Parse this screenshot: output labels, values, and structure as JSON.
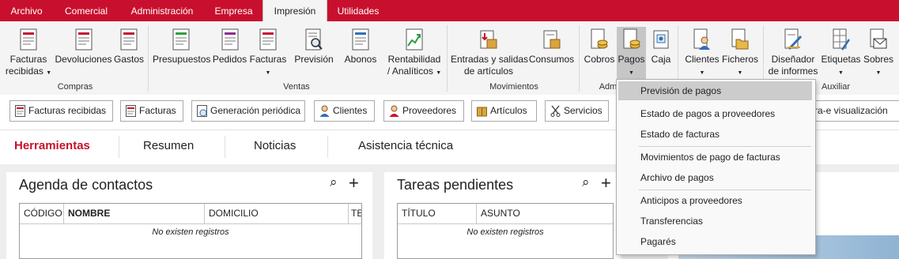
{
  "menu": {
    "tabs": [
      "Archivo",
      "Comercial",
      "Administración",
      "Empresa",
      "Impresión",
      "Utilidades"
    ],
    "active": "Impresión"
  },
  "ribbon": {
    "groups": {
      "compras": "Compras",
      "ventas": "Ventas",
      "movimientos": "Movimientos",
      "administracion": "Adm",
      "auxiliar": "Auxiliar"
    },
    "buttons": {
      "facturas_recibidas_1": "Facturas",
      "facturas_recibidas_2": "recibidas",
      "devoluciones": "Devoluciones",
      "gastos": "Gastos",
      "presupuestos": "Presupuestos",
      "pedidos": "Pedidos",
      "facturas": "Facturas",
      "prevision": "Previsión",
      "abonos": "Abonos",
      "rentabilidad_1": "Rentabilidad",
      "rentabilidad_2": "/ Analíticos",
      "entradas_1": "Entradas y salidas",
      "entradas_2": "de artículos",
      "consumos": "Consumos",
      "cobros": "Cobros",
      "pagos": "Pagos",
      "caja": "Caja",
      "clientes": "Clientes",
      "ficheros": "Ficheros",
      "disenador_1": "Diseñador",
      "disenador_2": "de informes",
      "etiquetas": "Etiquetas",
      "sobres": "Sobres"
    }
  },
  "shortcuts": {
    "facturas_recibidas": "Facturas recibidas",
    "facturas": "Facturas",
    "generacion_periodica": "Generación periódica",
    "clientes": "Clientes",
    "proveedores": "Proveedores",
    "articulos": "Artículos",
    "servicios": "Servicios",
    "factura_e_partial": "ctura-e visualización"
  },
  "nav": {
    "tabs": [
      "Herramientas",
      "Resumen",
      "Noticias",
      "Asistencia técnica"
    ],
    "active": "Herramientas"
  },
  "panels": {
    "agenda": {
      "title": "Agenda de contactos",
      "columns": [
        "CÓDIGO",
        "NOMBRE",
        "DOMICILIO",
        "TE"
      ],
      "empty": "No existen registros"
    },
    "tareas": {
      "title": "Tareas pendientes",
      "columns": [
        "TÍTULO",
        "ASUNTO"
      ],
      "empty": "No existen registros"
    },
    "search_glyph": "⌕",
    "add_glyph": "+"
  },
  "dropdown": {
    "items": [
      "Previsión de pagos",
      "Estado de pagos a proveedores",
      "Estado de facturas",
      "Movimientos de pago de facturas",
      "Archivo de pagos",
      "Anticipos a proveedores",
      "Transferencias",
      "Pagarés"
    ],
    "highlighted": "Previsión de pagos"
  },
  "colors": {
    "brand": "#c8102e",
    "ribbon_bg": "#f4f4f4",
    "selected_button": "#c6c6c6",
    "dropdown_highlight": "#cccccc"
  }
}
